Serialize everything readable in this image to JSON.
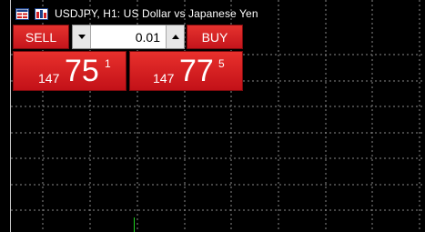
{
  "header": {
    "title": "USDJPY, H1:  US Dollar vs Japanese Yen",
    "icons": [
      "trade-panel-icon",
      "chart-settings-icon"
    ]
  },
  "trade_panel": {
    "sell_label": "SELL",
    "buy_label": "BUY",
    "lot_size": "0.01",
    "sell_price": {
      "prefix": "147",
      "big": "75",
      "sup": "1"
    },
    "buy_price": {
      "prefix": "147",
      "big": "77",
      "sup": "5"
    }
  },
  "colors": {
    "background": "#000000",
    "grid": "#8a8a8a",
    "button_red": "#d11f22",
    "candle": "#1fd21f"
  }
}
